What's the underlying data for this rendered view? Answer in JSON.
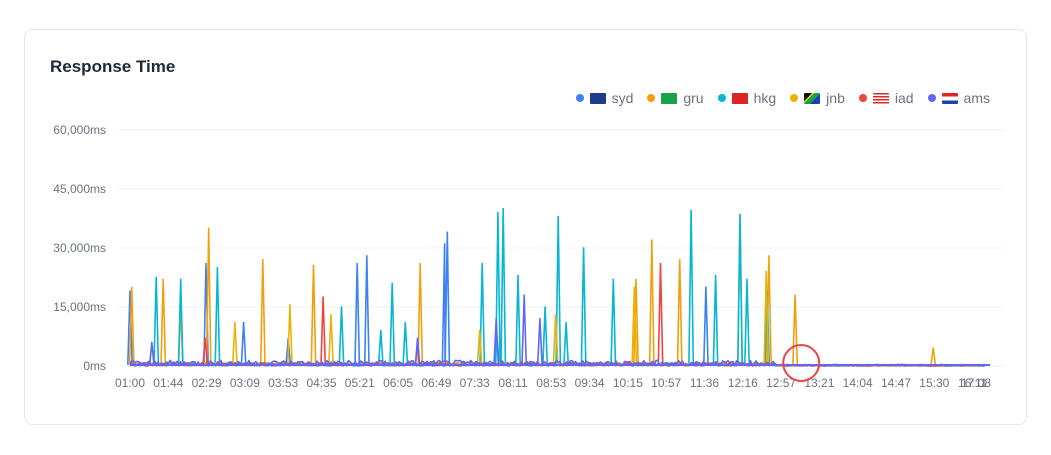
{
  "chart_data": {
    "type": "line",
    "title": "Response Time",
    "xlabel": "",
    "ylabel": "",
    "ylim": [
      0,
      60000
    ],
    "xlim": [
      "01:00",
      "17:08"
    ],
    "y_ticks": [
      "0ms",
      "15,000ms",
      "30,000ms",
      "45,000ms",
      "60,000ms"
    ],
    "y_tick_values": [
      0,
      15000,
      30000,
      45000,
      60000
    ],
    "x_ticks": [
      "01:00",
      "01:44",
      "02:29",
      "03:09",
      "03:53",
      "04:35",
      "05:21",
      "06:05",
      "06:49",
      "07:33",
      "08:11",
      "08:53",
      "09:34",
      "10:15",
      "10:57",
      "11:36",
      "12:16",
      "12:57",
      "13:21",
      "14:04",
      "14:47",
      "15:30",
      "16:11",
      "17:08"
    ],
    "grid": true,
    "legend_placement": "top-right",
    "annotation": {
      "type": "red-circle",
      "time": "13:48",
      "value": 0,
      "color": "#ef4444"
    },
    "series": [
      {
        "name": "syd",
        "flag": "AU",
        "color": "#3b82f6",
        "spikes": [
          [
            "01:00",
            19000
          ],
          [
            "02:27",
            26000
          ],
          [
            "03:10",
            11000
          ],
          [
            "04:01",
            7000
          ],
          [
            "05:20",
            26000
          ],
          [
            "05:31",
            28000
          ],
          [
            "07:00",
            31000
          ],
          [
            "07:03",
            34000
          ],
          [
            "08:00",
            7000
          ],
          [
            "11:59",
            20000
          ],
          [
            "13:08",
            6000
          ]
        ]
      },
      {
        "name": "gru",
        "flag": "BR",
        "color": "#f59e0b",
        "spikes": [
          [
            "01:02",
            20000
          ],
          [
            "01:38",
            22000
          ],
          [
            "01:58",
            15000
          ],
          [
            "02:30",
            35000
          ],
          [
            "03:32",
            27000
          ],
          [
            "04:30",
            25500
          ],
          [
            "06:32",
            26000
          ],
          [
            "10:39",
            22000
          ],
          [
            "10:57",
            32000
          ],
          [
            "11:29",
            27000
          ],
          [
            "12:38",
            38000
          ],
          [
            "13:11",
            28000
          ],
          [
            "13:41",
            18000
          ],
          [
            "16:19",
            4500
          ]
        ]
      },
      {
        "name": "hkg",
        "flag": "HK",
        "color": "#06b6d4",
        "spikes": [
          [
            "01:30",
            22500
          ],
          [
            "01:58",
            22000
          ],
          [
            "02:40",
            25000
          ],
          [
            "05:02",
            15000
          ],
          [
            "05:47",
            9000
          ],
          [
            "06:00",
            21000
          ],
          [
            "06:15",
            11000
          ],
          [
            "07:43",
            26000
          ],
          [
            "08:01",
            39000
          ],
          [
            "08:07",
            40000
          ],
          [
            "08:24",
            23000
          ],
          [
            "08:55",
            15000
          ],
          [
            "09:10",
            38000
          ],
          [
            "09:19",
            11000
          ],
          [
            "09:39",
            30000
          ],
          [
            "10:13",
            22000
          ],
          [
            "11:42",
            39500
          ],
          [
            "12:10",
            23000
          ],
          [
            "12:38",
            38500
          ],
          [
            "12:46",
            22000
          ],
          [
            "13:09",
            19000
          ]
        ]
      },
      {
        "name": "jnb",
        "flag": "ZA",
        "color": "#eab308",
        "spikes": [
          [
            "03:00",
            11000
          ],
          [
            "04:03",
            15500
          ],
          [
            "04:50",
            13000
          ],
          [
            "07:40",
            9000
          ],
          [
            "09:07",
            13000
          ],
          [
            "10:37",
            20000
          ],
          [
            "13:08",
            24000
          ]
        ]
      },
      {
        "name": "iad",
        "flag": "US",
        "color": "#ef4444",
        "spikes": [
          [
            "02:26",
            7000
          ],
          [
            "04:41",
            17500
          ],
          [
            "06:29",
            5000
          ],
          [
            "11:07",
            26000
          ]
        ]
      },
      {
        "name": "ams",
        "flag": "NL",
        "color": "#6366f1",
        "spikes": [
          [
            "01:25",
            6000
          ],
          [
            "06:29",
            7000
          ],
          [
            "07:59",
            12000
          ],
          [
            "08:31",
            18000
          ],
          [
            "08:49",
            12000
          ]
        ]
      }
    ]
  }
}
